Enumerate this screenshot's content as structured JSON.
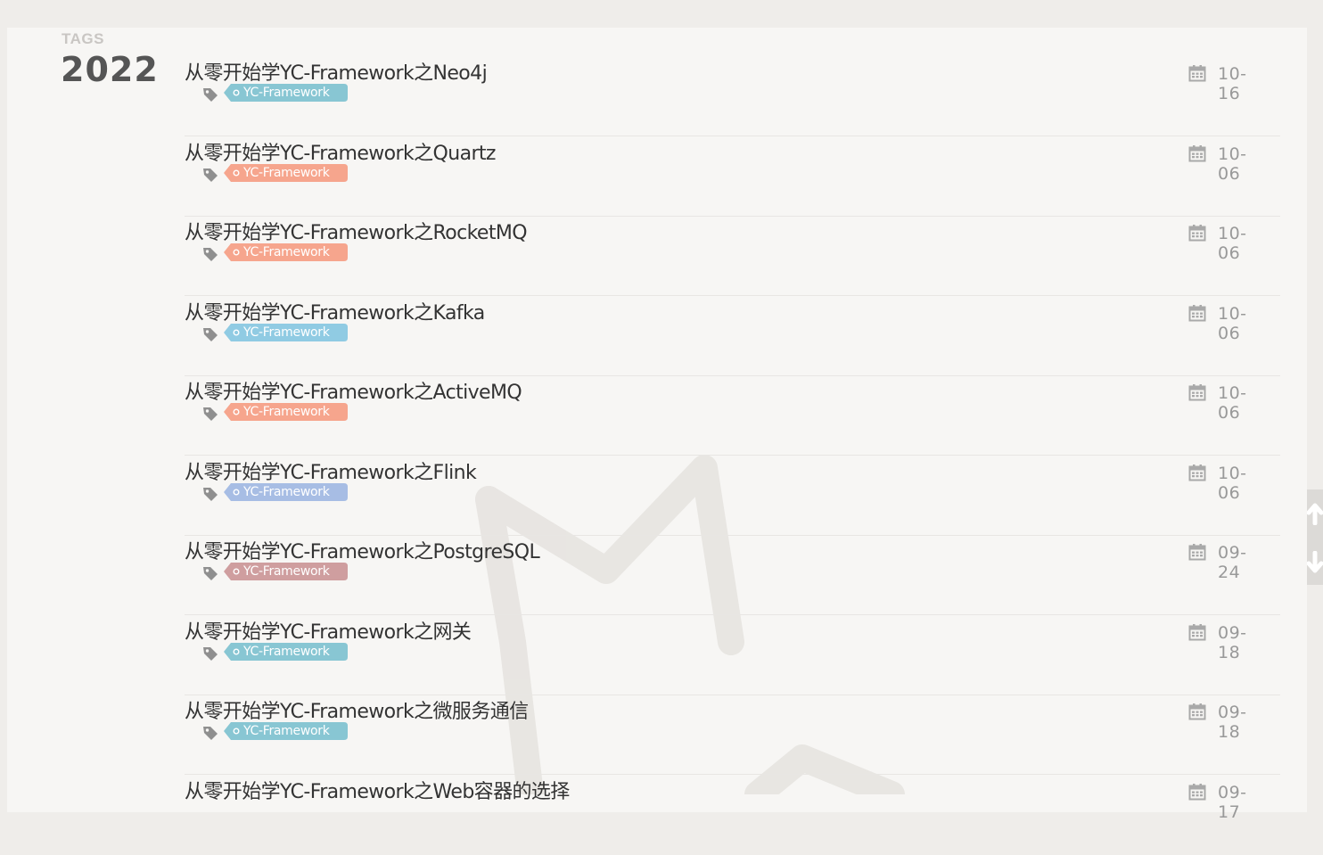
{
  "archive": {
    "section_label": "TAGS",
    "year": "2022"
  },
  "posts": [
    {
      "title": "从零开始学YC-Framework之Neo4j",
      "tag": "YC-Framework",
      "tag_color": "#88c6d3",
      "date": "10-16",
      "icon": "tag-icon"
    },
    {
      "title": "从零开始学YC-Framework之Quartz",
      "tag": "YC-Framework",
      "tag_color": "#f6a58d",
      "date": "10-06",
      "icon": "tag-icon"
    },
    {
      "title": "从零开始学YC-Framework之RocketMQ",
      "tag": "YC-Framework",
      "tag_color": "#f6a58d",
      "date": "10-06",
      "icon": "tag-icon"
    },
    {
      "title": "从零开始学YC-Framework之Kafka",
      "tag": "YC-Framework",
      "tag_color": "#90cbe3",
      "date": "10-06",
      "icon": "tag-icon"
    },
    {
      "title": "从零开始学YC-Framework之ActiveMQ",
      "tag": "YC-Framework",
      "tag_color": "#f6a58d",
      "date": "10-06",
      "icon": "tag-icon"
    },
    {
      "title": "从零开始学YC-Framework之Flink",
      "tag": "YC-Framework",
      "tag_color": "#a7bde4",
      "date": "10-06",
      "icon": "tag-icon"
    },
    {
      "title": "从零开始学YC-Framework之PostgreSQL",
      "tag": "YC-Framework",
      "tag_color": "#cf9e9f",
      "date": "09-24",
      "icon": "tag-icon"
    },
    {
      "title": "从零开始学YC-Framework之网关",
      "tag": "YC-Framework",
      "tag_color": "#88c6d3",
      "date": "09-18",
      "icon": "tag-icon"
    },
    {
      "title": "从零开始学YC-Framework之微服务通信",
      "tag": "YC-Framework",
      "tag_color": "#88c6d3",
      "date": "09-18",
      "icon": "tag-icon"
    },
    {
      "title": "从零开始学YC-Framework之Web容器的选择",
      "tag": "",
      "tag_color": "",
      "date": "09-17",
      "icon": ""
    }
  ],
  "icons": {
    "date": "calendar-icon",
    "scroll_up": "arrow-up-icon",
    "scroll_down": "arrow-down-icon"
  }
}
